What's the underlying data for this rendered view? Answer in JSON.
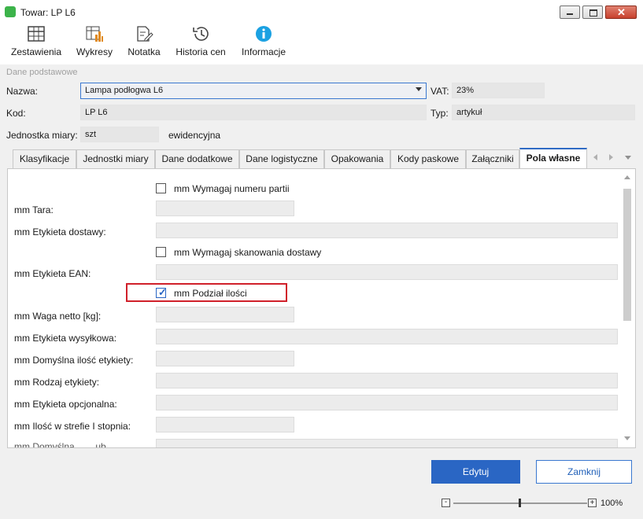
{
  "window": {
    "title": "Towar: LP L6"
  },
  "toolbar": {
    "items": [
      {
        "label": "Zestawienia",
        "icon": "table-icon"
      },
      {
        "label": "Wykresy",
        "icon": "chart-icon"
      },
      {
        "label": "Notatka",
        "icon": "note-icon"
      },
      {
        "label": "Historia cen",
        "icon": "history-icon"
      },
      {
        "label": "Informacje",
        "icon": "info-icon"
      }
    ]
  },
  "basic": {
    "group_label": "Dane podstawowe",
    "name_label": "Nazwa:",
    "name_value": "Lampa podłogwa L6",
    "vat_label": "VAT:",
    "vat_value": "23%",
    "code_label": "Kod:",
    "code_value": "LP L6",
    "type_label": "Typ:",
    "type_value": "artykuł",
    "unit_label": "Jednostka miary:",
    "unit_value": "szt",
    "unit_note": "ewidencyjna"
  },
  "tabs": [
    {
      "label": "Klasyfikacje",
      "active": false
    },
    {
      "label": "Jednostki miary",
      "active": false
    },
    {
      "label": "Dane dodatkowe",
      "active": false
    },
    {
      "label": "Dane logistyczne",
      "active": false
    },
    {
      "label": "Opakowania",
      "active": false
    },
    {
      "label": "Kody paskowe",
      "active": false
    },
    {
      "label": "Załączniki",
      "active": false
    },
    {
      "label": "Pola własne",
      "active": true
    }
  ],
  "custom_fields": {
    "require_batch": {
      "label": "mm Wymagaj numeru partii",
      "checked": false
    },
    "tare": {
      "label": "mm Tara:",
      "value": ""
    },
    "delivery_label": {
      "label": "mm Etykieta dostawy:",
      "value": ""
    },
    "require_scan": {
      "label": "mm Wymagaj skanowania dostawy",
      "checked": false
    },
    "ean_label": {
      "label": "mm Etykieta EAN:",
      "value": ""
    },
    "qty_split": {
      "label": "mm Podział ilości",
      "checked": true
    },
    "net_weight": {
      "label": "mm Waga netto [kg]:",
      "value": ""
    },
    "shipping_label": {
      "label": "mm Etykieta wysyłkowa:",
      "value": ""
    },
    "default_label_qty": {
      "label": "mm Domyślna ilość etykiety:",
      "value": ""
    },
    "label_type": {
      "label": "mm Rodzaj etykiety:",
      "value": ""
    },
    "optional_label": {
      "label": "mm Etykieta opcjonalna:",
      "value": ""
    },
    "zone1_qty": {
      "label": "mm Ilość w strefie I stopnia:",
      "value": ""
    },
    "partial_label": {
      "label": "mm Domyślna ... ...ub ..."
    }
  },
  "buttons": {
    "edit": "Edytuj",
    "close": "Zamknij"
  },
  "zoom": {
    "value": "100%"
  },
  "colors": {
    "accent": "#2a66c4",
    "highlight_box": "#d0202a"
  }
}
